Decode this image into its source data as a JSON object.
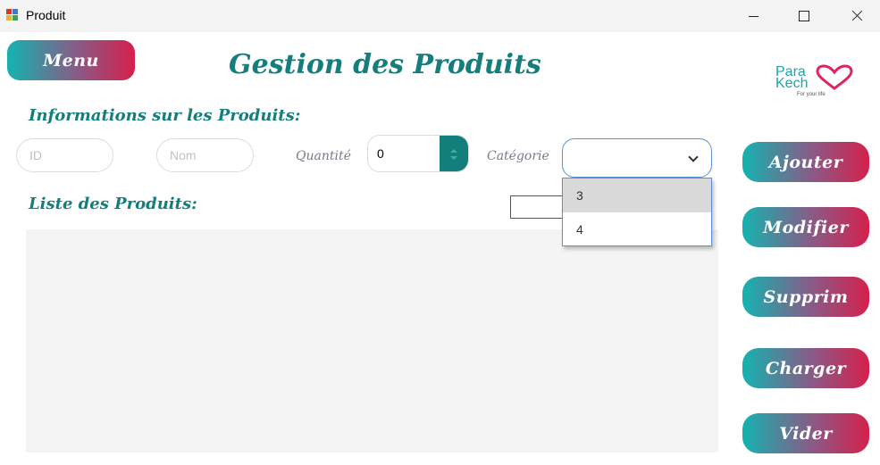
{
  "window": {
    "title": "Produit"
  },
  "header": {
    "menu_label": "Menu",
    "page_title": "Gestion des Produits",
    "logo": {
      "line1": "Para",
      "line2": "Kech",
      "tagline": "For your life",
      "icon": "heart-icon"
    }
  },
  "form": {
    "section_title": "Informations sur les Produits:",
    "id_placeholder": "ID",
    "nom_placeholder": "Nom",
    "quantite_label": "Quantité",
    "quantite_value": "0",
    "categorie_label": "Catégorie",
    "categorie_value": "",
    "categorie_options": [
      "3",
      "4"
    ]
  },
  "list": {
    "section_title": "Liste des Produits:"
  },
  "actions": {
    "ajouter": "Ajouter",
    "modifier": "Modifier",
    "supprimer": "Supprim",
    "charger": "Charger",
    "vider": "Vider"
  },
  "colors": {
    "accent_teal": "#147d7d",
    "gradient_start": "#14b3b0",
    "gradient_end": "#d6204c",
    "heart": "#e0245e"
  }
}
